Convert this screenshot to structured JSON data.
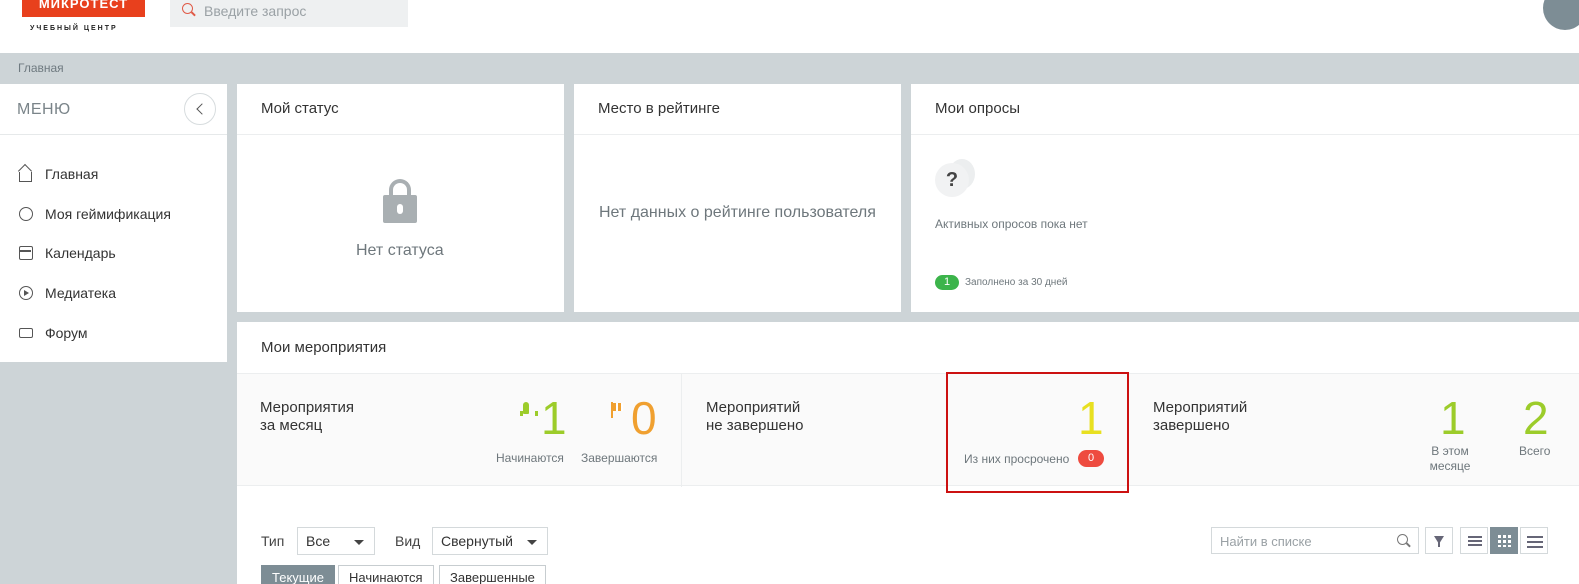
{
  "header": {
    "logo_text": "МИКРОТЕСТ",
    "logo_sub": "УЧЕБНЫЙ ЦЕНТР",
    "search_placeholder": "Введите запрос"
  },
  "breadcrumb": "Главная",
  "sidebar": {
    "title": "МЕНЮ",
    "items": [
      {
        "label": "Главная",
        "icon": "home-icon"
      },
      {
        "label": "Моя геймификация",
        "icon": "medal-icon"
      },
      {
        "label": "Календарь",
        "icon": "calendar-icon"
      },
      {
        "label": "Медиатека",
        "icon": "play-icon"
      },
      {
        "label": "Форум",
        "icon": "forum-icon"
      }
    ]
  },
  "status_card": {
    "title": "Мой статус",
    "text": "Нет статуса"
  },
  "rating_card": {
    "title": "Место в рейтинге",
    "text": "Нет данных о рейтинге пользователя"
  },
  "polls_card": {
    "title": "Мои опросы",
    "text": "Активных опросов пока нет",
    "filled_count": "1",
    "filled_text": "Заполнено за 30 дней"
  },
  "events": {
    "title": "Мои мероприятия",
    "month": {
      "label_line1": "Мероприятия",
      "label_line2": "за месяц",
      "starting": "1",
      "starting_label": "Начинаются",
      "ending": "0",
      "ending_label": "Завершаются"
    },
    "not_completed": {
      "label_line1": "Мероприятий",
      "label_line2": "не завершено",
      "count": "1",
      "overdue_label": "Из них просрочено",
      "overdue_count": "0"
    },
    "completed": {
      "label_line1": "Мероприятий",
      "label_line2": "завершено",
      "this_month": "1",
      "this_month_label_1": "В этом",
      "this_month_label_2": "месяце",
      "total": "2",
      "total_label": "Всего"
    }
  },
  "filters": {
    "type_label": "Тип",
    "type_value": "Все",
    "view_label": "Вид",
    "view_value": "Свернутый",
    "find_placeholder": "Найти в списке"
  },
  "tabs": [
    "Текущие",
    "Начинаются",
    "Завершенные"
  ],
  "colors": {
    "accent_orange": "#f0a030",
    "accent_green": "#9ccc2a",
    "accent_yellow": "#e8e020",
    "alert_red": "#ee4b3f",
    "logo_red": "#e8401d"
  }
}
